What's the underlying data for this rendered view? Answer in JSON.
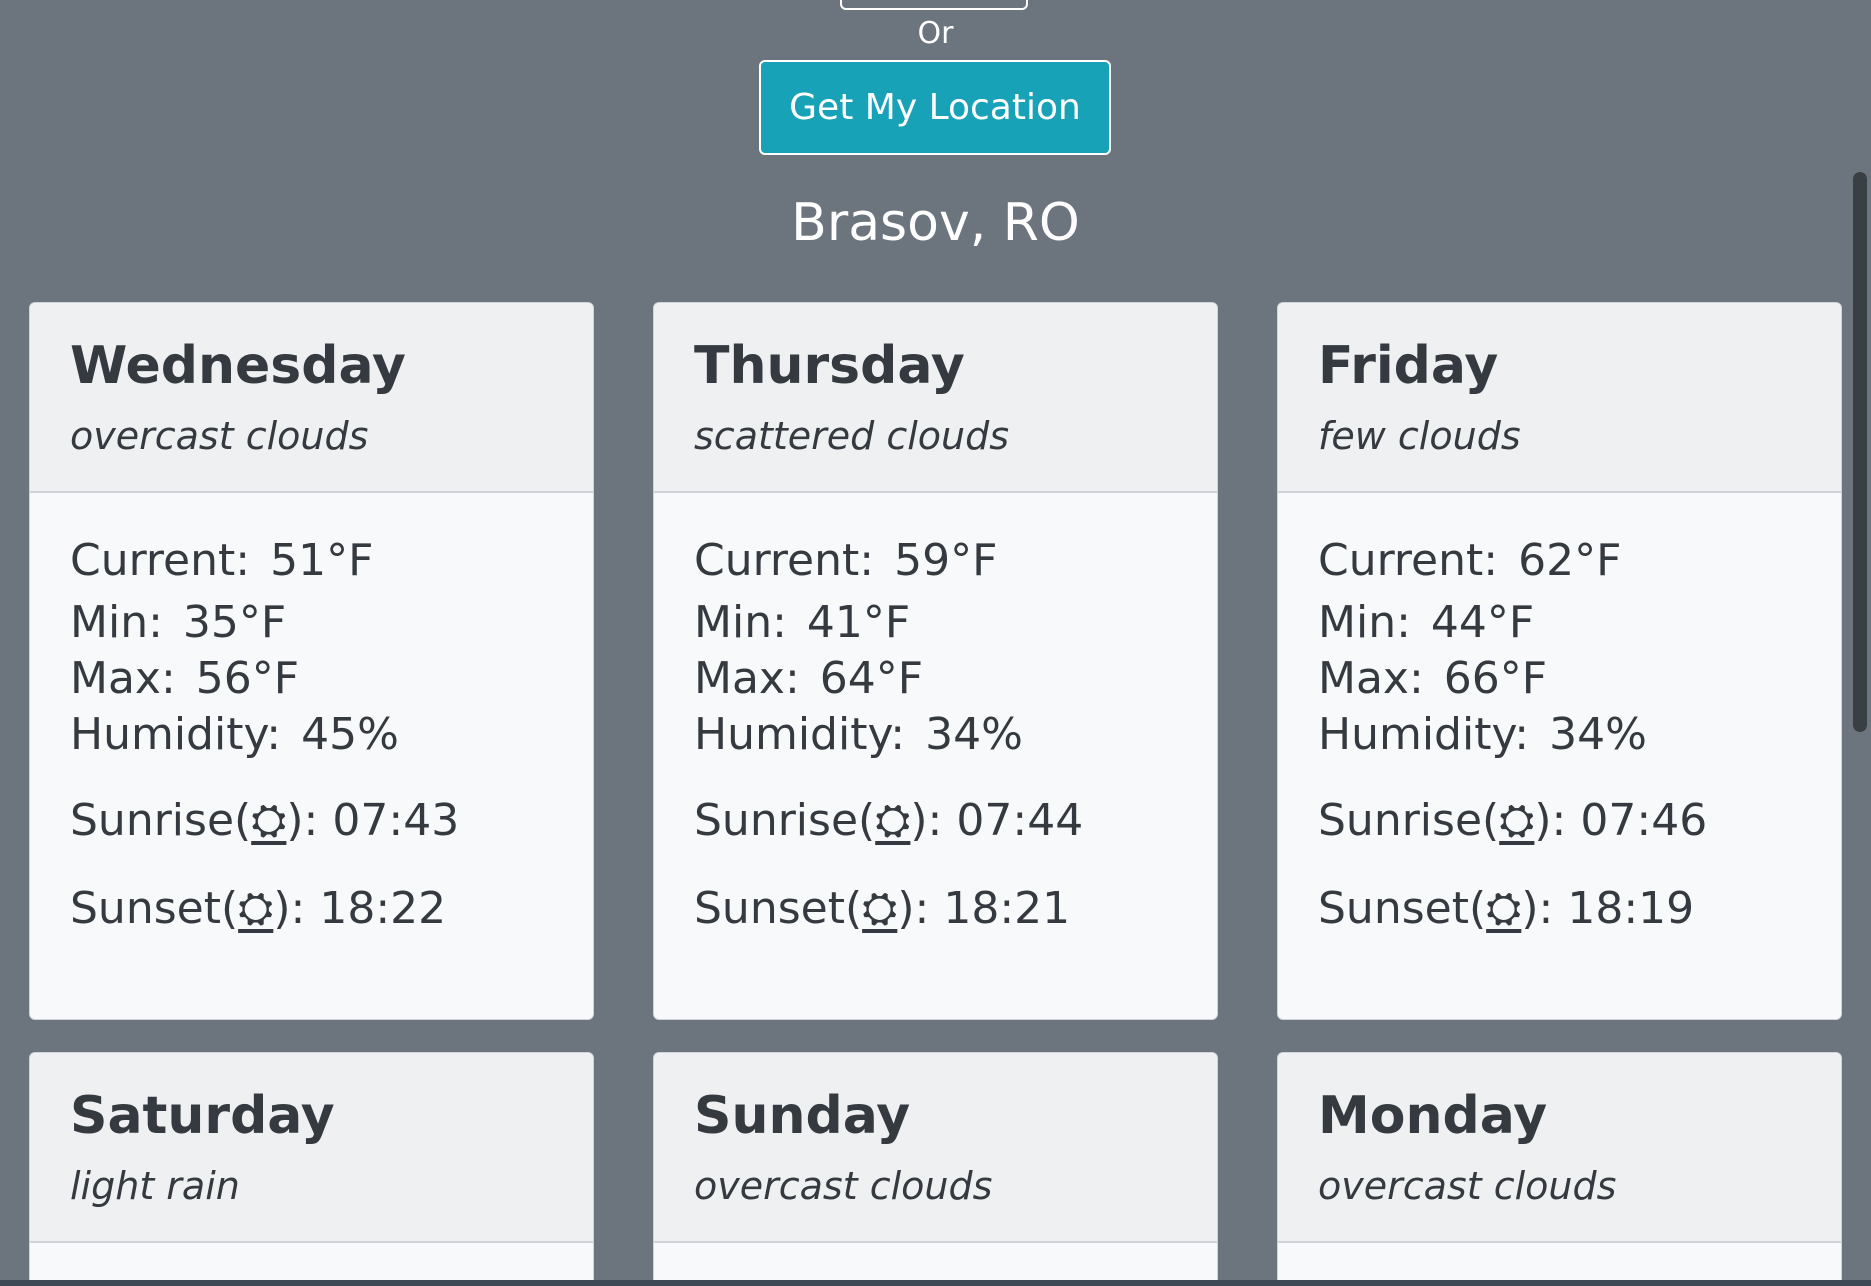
{
  "search": {
    "or_text": "Or",
    "locate_button_label": "Get My Location"
  },
  "location": {
    "title": "Brasov, RO"
  },
  "labels": {
    "current": "Current:",
    "min": "Min:",
    "max": "Max:",
    "humidity": "Humidity:",
    "sunrise": "Sunrise(",
    "sunset": "Sunset(",
    "close_paren": "):"
  },
  "icons": {
    "sunrise": "⛭",
    "sunset": "⛭"
  },
  "forecast": [
    {
      "day": "Wednesday",
      "description": "overcast clouds",
      "current": "51°F",
      "min": "35°F",
      "max": "56°F",
      "humidity": "45%",
      "sunrise": "07:43",
      "sunset": "18:22"
    },
    {
      "day": "Thursday",
      "description": "scattered clouds",
      "current": "59°F",
      "min": "41°F",
      "max": "64°F",
      "humidity": "34%",
      "sunrise": "07:44",
      "sunset": "18:21"
    },
    {
      "day": "Friday",
      "description": "few clouds",
      "current": "62°F",
      "min": "44°F",
      "max": "66°F",
      "humidity": "34%",
      "sunrise": "07:46",
      "sunset": "18:19"
    },
    {
      "day": "Saturday",
      "description": "light rain"
    },
    {
      "day": "Sunday",
      "description": "overcast clouds"
    },
    {
      "day": "Monday",
      "description": "overcast clouds"
    }
  ]
}
